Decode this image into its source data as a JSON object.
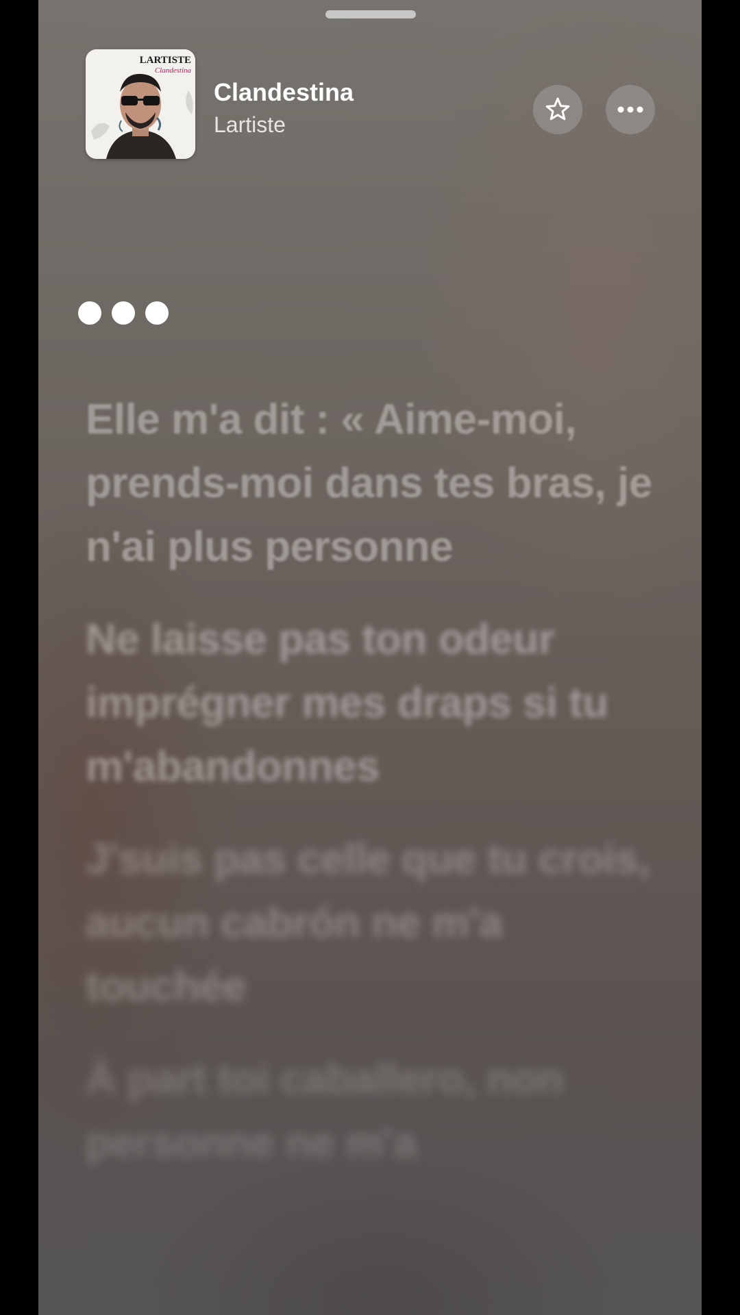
{
  "now_playing": {
    "title": "Clandestina",
    "artist": "Lartiste",
    "artwork": {
      "label_top": "LARTISTE",
      "label_script": "Clandestina",
      "icon": "album-artwork-icon"
    }
  },
  "actions": {
    "favorite_icon": "star-icon",
    "more_icon": "more-ellipsis-icon"
  },
  "lyrics": {
    "indicator_icon": "interlude-dots-icon",
    "lines": [
      "Elle m'a dit : « Aime-moi, prends-moi dans tes bras, je n'ai plus personne",
      "Ne laisse pas ton odeur imprégner mes draps si tu m'abandonnes",
      "J'suis pas celle que tu crois, aucun cabrón ne m'a touchée",
      "À part toi caballero, non personne ne m'a"
    ]
  },
  "colors": {
    "background_top": "#76736e",
    "background_bottom": "#565454",
    "text_primary": "#ffffff",
    "lyric_inactive": "#cdc8c4"
  }
}
